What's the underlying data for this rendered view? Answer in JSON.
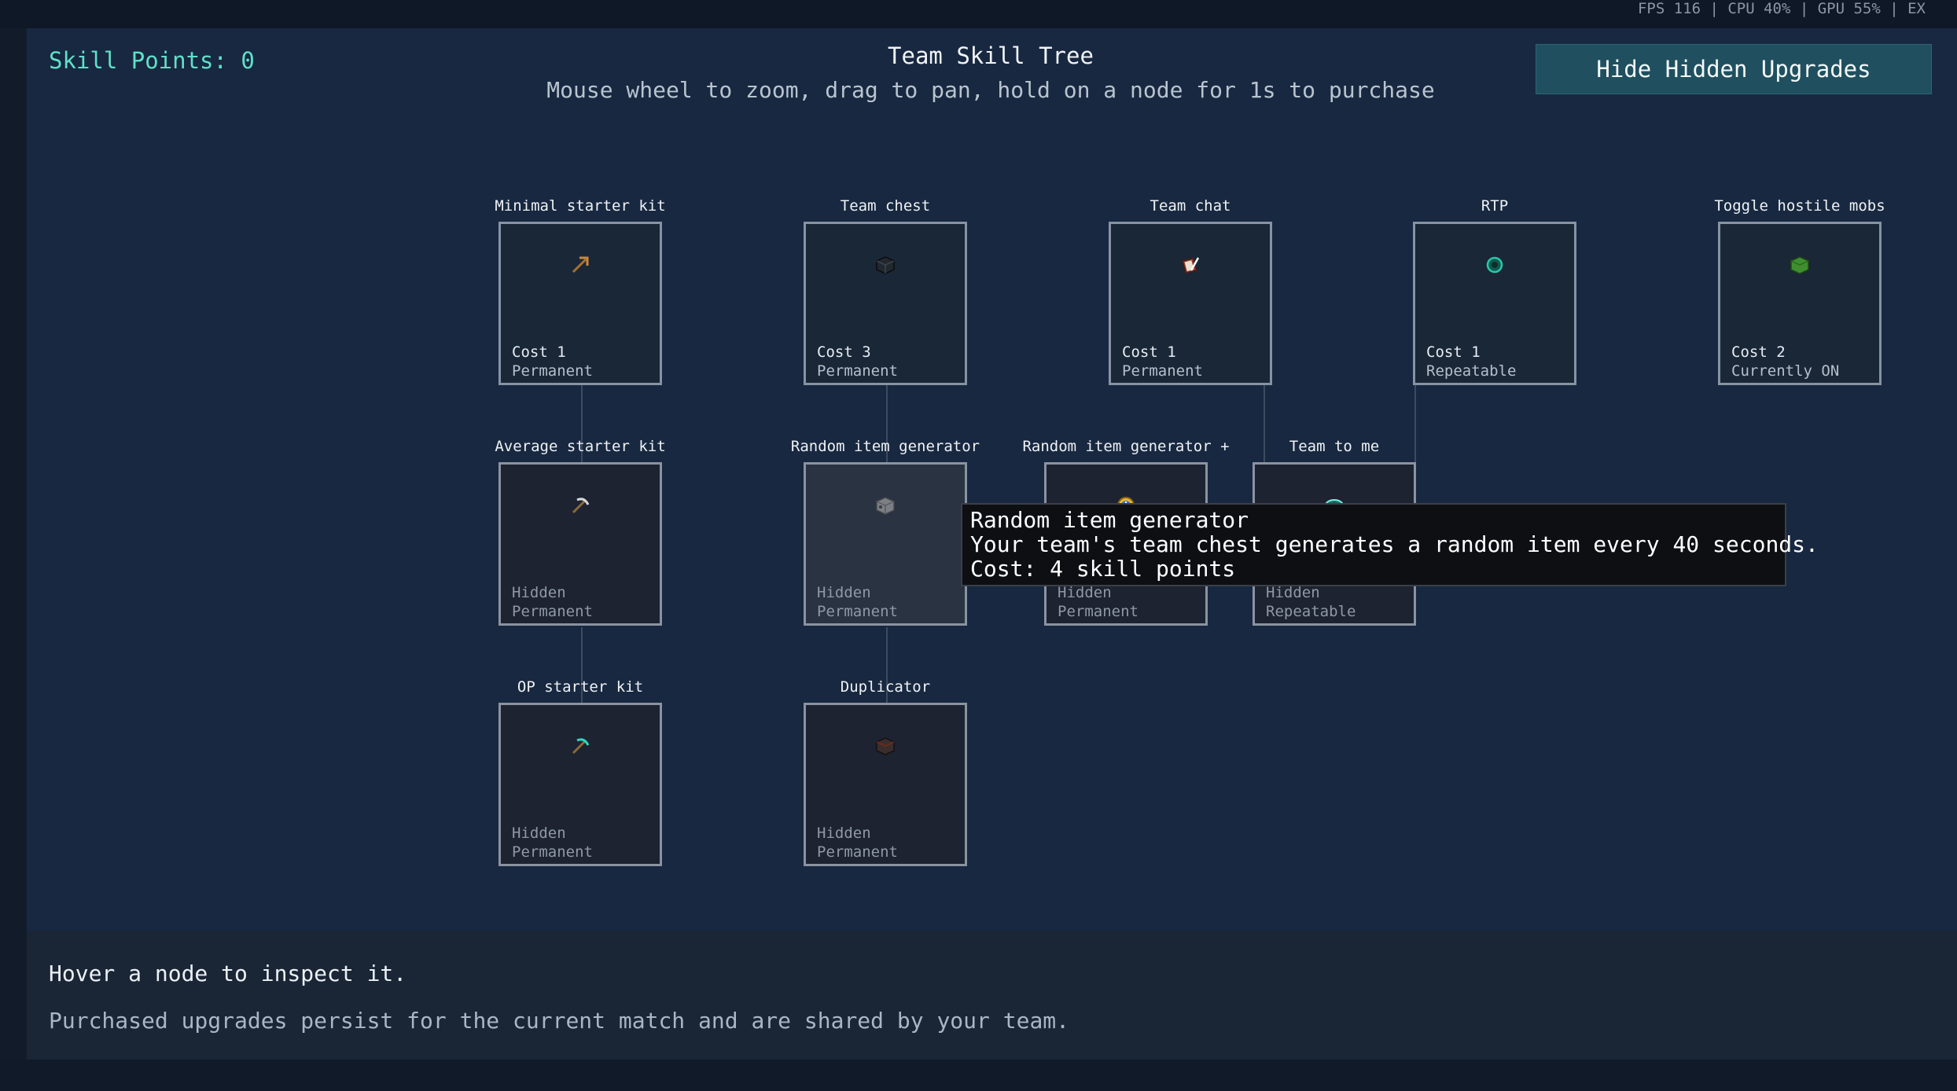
{
  "top_stats": "FPS 116 | CPU 40% | GPU 55% | EX",
  "skill_points": "Skill Points: 0",
  "header": {
    "title": "Team Skill Tree",
    "subtitle": "Mouse wheel to zoom, drag to pan, hold on a node for 1s to purchase"
  },
  "hide_button_label": "Hide Hidden Upgrades",
  "nodes": [
    {
      "label": "Minimal starter kit",
      "icon": "wooden-pickaxe-icon",
      "line1": "Cost 1",
      "line2": "Permanent",
      "hidden": false
    },
    {
      "label": "Team chest",
      "icon": "ender-chest-icon",
      "line1": "Cost 3",
      "line2": "Permanent",
      "hidden": false
    },
    {
      "label": "Team chat",
      "icon": "book-and-quill-icon",
      "line1": "Cost 1",
      "line2": "Permanent",
      "hidden": false
    },
    {
      "label": "RTP",
      "icon": "ender-pearl-icon",
      "line1": "Cost 1",
      "line2": "Repeatable",
      "hidden": false
    },
    {
      "label": "Toggle hostile mobs",
      "icon": "creeper-head-icon",
      "line1": "Cost 2",
      "line2": "Currently ON",
      "hidden": false
    },
    {
      "label": "Average starter kit",
      "icon": "iron-pickaxe-icon",
      "line1": "Hidden",
      "line2": "Permanent",
      "hidden": true
    },
    {
      "label": "Random item generator",
      "icon": "dispenser-block-icon",
      "line1": "Hidden",
      "line2": "Permanent",
      "hidden": true
    },
    {
      "label": "Random item generator +",
      "icon": "clock-icon",
      "line1": "Hidden",
      "line2": "Permanent",
      "hidden": true
    },
    {
      "label": "Team to me",
      "icon": "ender-eye-icon",
      "line1": "Hidden",
      "line2": "Repeatable",
      "hidden": true
    },
    {
      "label": "OP starter kit",
      "icon": "diamond-pickaxe-icon",
      "line1": "Hidden",
      "line2": "Permanent",
      "hidden": true
    },
    {
      "label": "Duplicator",
      "icon": "crafter-block-icon",
      "line1": "Hidden",
      "line2": "Permanent",
      "hidden": true
    }
  ],
  "tooltip": {
    "name": "Random item generator",
    "description": "Your team's team chest generates a random item every 40 seconds.",
    "cost": "Cost: 4 skill points"
  },
  "footer": {
    "hint": "Hover a node to inspect it.",
    "info": "Purchased upgrades persist for the current match and are shared by your team."
  },
  "colors": {
    "accent_teal": "#5fe0c8",
    "button_bg": "#20505f",
    "panel_bg": "#182840",
    "node_border": "#8793a2"
  }
}
